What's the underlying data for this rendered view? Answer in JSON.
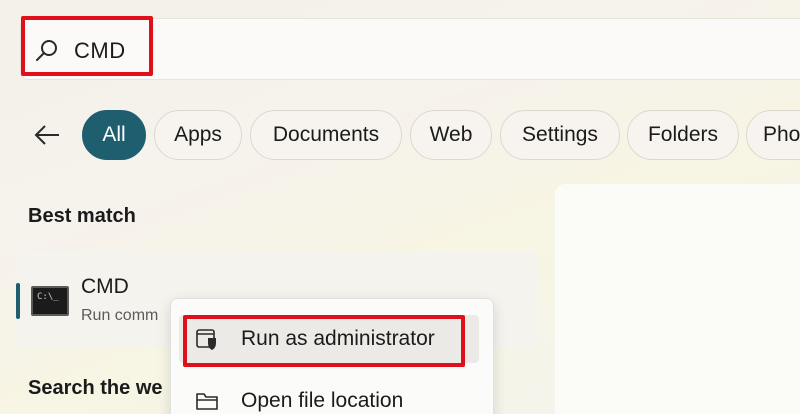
{
  "search": {
    "query": "CMD"
  },
  "filters": {
    "items": [
      {
        "label": "All",
        "active": true
      },
      {
        "label": "Apps"
      },
      {
        "label": "Documents"
      },
      {
        "label": "Web"
      },
      {
        "label": "Settings"
      },
      {
        "label": "Folders"
      },
      {
        "label": "Pho"
      }
    ]
  },
  "best_match": {
    "heading": "Best match",
    "title": "CMD",
    "subtitle": "Run comm"
  },
  "search_web": {
    "heading": "Search the we"
  },
  "context_menu": {
    "items": [
      {
        "label": "Run as administrator",
        "icon": "shield-icon"
      },
      {
        "label": "Open file location",
        "icon": "folder-icon"
      }
    ]
  },
  "colors": {
    "accent": "#1e5e6e",
    "highlight": "#e0101a"
  }
}
